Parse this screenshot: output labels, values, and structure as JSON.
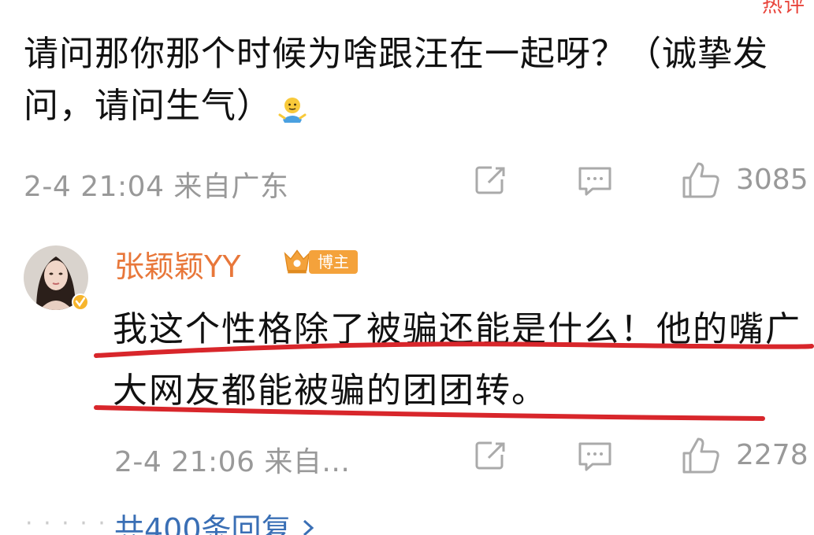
{
  "top_fragment": "热评",
  "parent_comment": {
    "text": "请问那你那个时候为啥跟汪在一起呀？（诚挚发问，请问生气）",
    "emoji_icon": "shrug-emoji",
    "timestamp": "2-4 21:04 来自广东",
    "share_icon": "share-icon",
    "comment_icon": "comment-icon",
    "like_icon": "thumbs-up-icon",
    "like_count": "3085"
  },
  "reply": {
    "username": "张颖颖YY",
    "badge_label": "博主",
    "badge_icon": "crown-badge-icon",
    "verified_icon": "verified-icon",
    "text": "我这个性格除了被骗还能是什么！他的嘴广大网友都能被骗的团团转。",
    "timestamp": "2-4 21:06 来自...",
    "share_icon": "share-icon",
    "comment_icon": "comment-icon",
    "like_icon": "thumbs-up-icon",
    "like_count": "2278"
  },
  "more_replies": {
    "label": "共400条回复",
    "chevron_icon": "chevron-right-icon"
  },
  "colors": {
    "username": "#e8773a",
    "badge": "#f4a23b",
    "meta_gray": "#999999",
    "link_blue": "#3a6fb5",
    "underline_red": "#d8262b"
  }
}
